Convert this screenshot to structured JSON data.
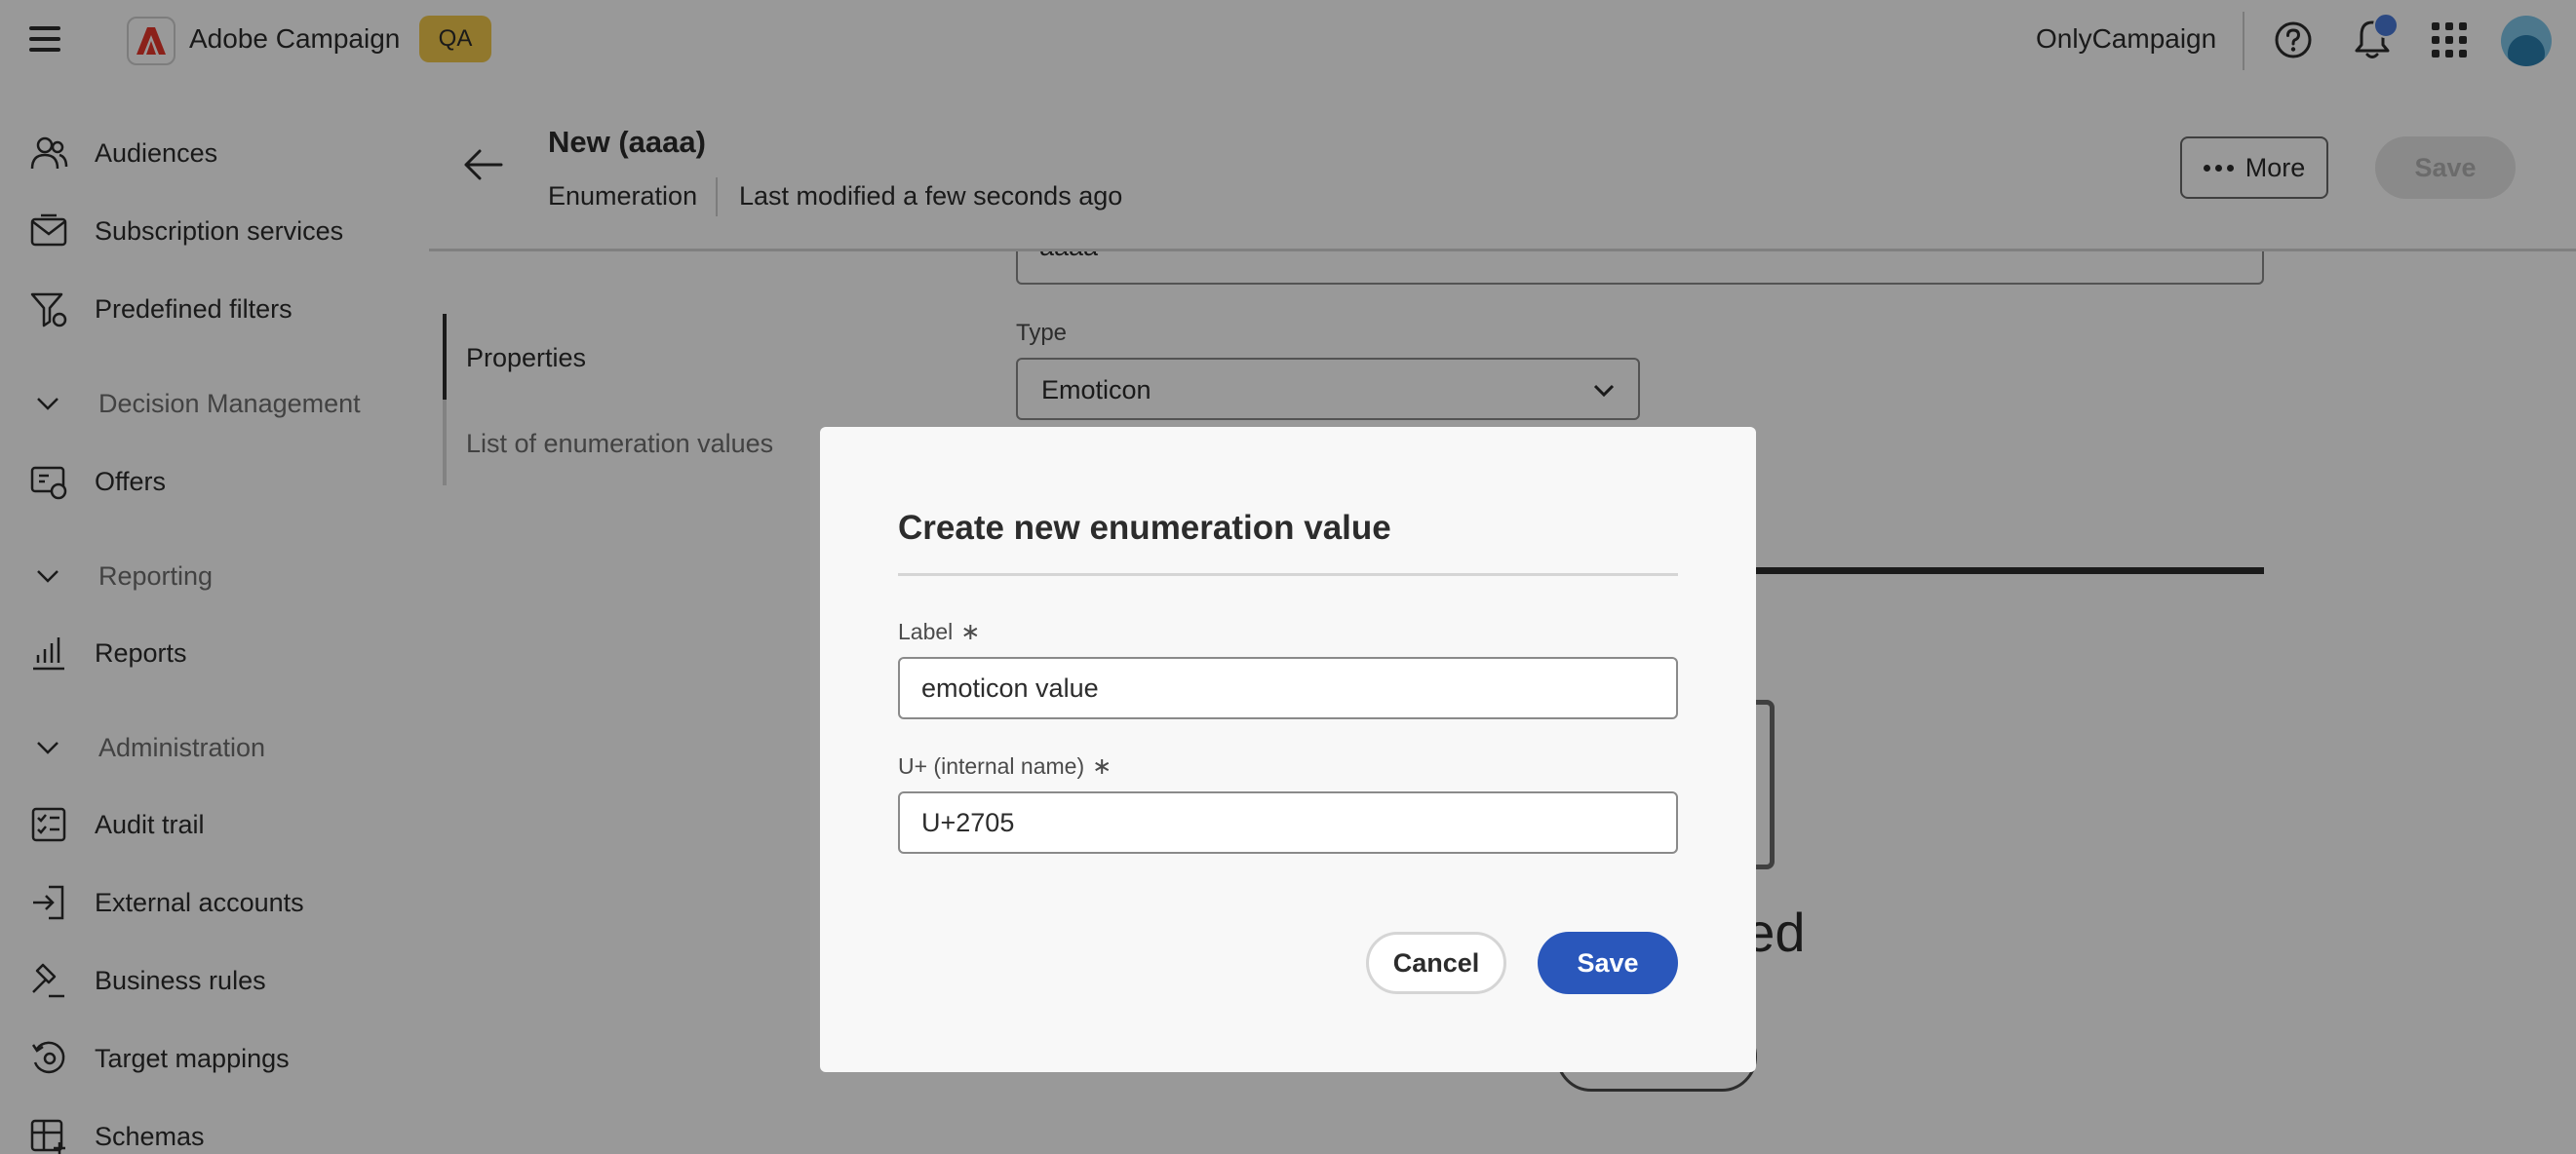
{
  "topbar": {
    "app_name": "Adobe Campaign",
    "environment_badge": "QA",
    "org_name": "OnlyCampaign"
  },
  "sidebar": {
    "items": [
      {
        "label": "Audiences",
        "icon": "audiences-icon"
      },
      {
        "label": "Subscription services",
        "icon": "subscription-icon"
      },
      {
        "label": "Predefined filters",
        "icon": "filter-icon"
      },
      {
        "label": "Decision Management",
        "type": "section"
      },
      {
        "label": "Offers",
        "icon": "offers-icon"
      },
      {
        "label": "Reporting",
        "type": "section"
      },
      {
        "label": "Reports",
        "icon": "reports-icon"
      },
      {
        "label": "Administration",
        "type": "section"
      },
      {
        "label": "Audit trail",
        "icon": "audit-trail-icon"
      },
      {
        "label": "External accounts",
        "icon": "external-accounts-icon"
      },
      {
        "label": "Business rules",
        "icon": "business-rules-icon"
      },
      {
        "label": "Target mappings",
        "icon": "target-mappings-icon"
      },
      {
        "label": "Schemas",
        "icon": "schemas-icon"
      }
    ]
  },
  "header": {
    "title": "New (aaaa)",
    "subtype": "Enumeration",
    "modified": "Last modified a few seconds ago",
    "more_label": "More",
    "save_label": "Save"
  },
  "content": {
    "tabs": [
      {
        "label": "Properties",
        "active": true
      },
      {
        "label": "List of enumeration values",
        "active": false
      }
    ],
    "name_value": "aaaa",
    "type_label": "Type",
    "type_value": "Emoticon",
    "empty_text": "ues added"
  },
  "dialog": {
    "title": "Create new enumeration value",
    "label_field": {
      "label": "Label",
      "value": "emoticon value"
    },
    "internal_field": {
      "label": "U+ (internal name)",
      "value": "U+2705"
    },
    "required_marker": "∗",
    "cancel_label": "Cancel",
    "save_label": "Save"
  },
  "colors": {
    "primary_button": "#2a57bb",
    "badge": "#f2c94c",
    "notification_dot": "#4a7bd9",
    "adobe_red": "#e8382c"
  }
}
